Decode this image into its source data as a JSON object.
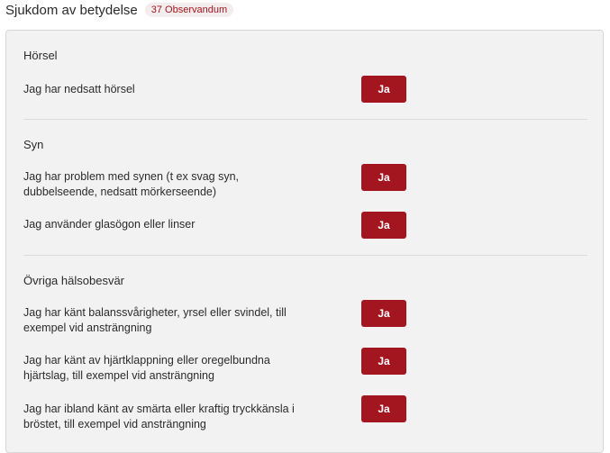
{
  "header": {
    "title": "Sjukdom av betydelse",
    "badge": "37 Observandum"
  },
  "sections": [
    {
      "title": "Hörsel",
      "questions": [
        {
          "text": "Jag har nedsatt hörsel",
          "button": "Ja"
        }
      ]
    },
    {
      "title": "Syn",
      "questions": [
        {
          "text": "Jag har problem med synen (t ex svag syn, dubbelseende, nedsatt mörkerseende)",
          "button": "Ja"
        },
        {
          "text": "Jag använder glasögon eller linser",
          "button": "Ja"
        }
      ]
    },
    {
      "title": "Övriga hälsobesvär",
      "questions": [
        {
          "text": "Jag har känt balanssvårigheter, yrsel eller svindel, till exempel vid ansträngning",
          "button": "Ja"
        },
        {
          "text": "Jag har känt av hjärtklappning eller oregelbundna hjärtslag, till exempel vid ansträngning",
          "button": "Ja"
        },
        {
          "text": "Jag har ibland känt av smärta eller kraftig tryckkänsla i bröstet, till exempel vid ansträngning",
          "button": "Ja"
        }
      ]
    }
  ],
  "colors": {
    "accent": "#a3151f",
    "panel_bg": "#f2f2f2",
    "badge_bg": "#f3eded"
  }
}
